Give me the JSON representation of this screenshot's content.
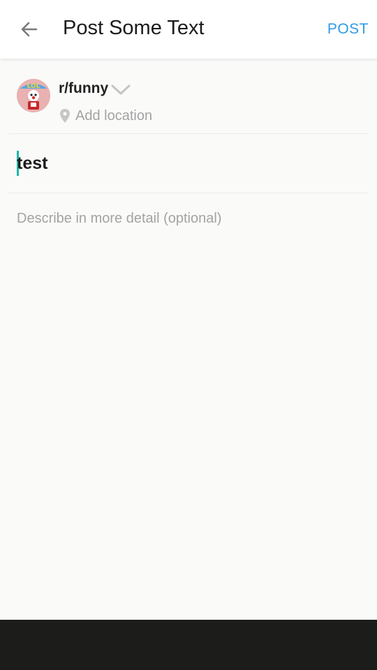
{
  "header": {
    "title": "Post Some Text",
    "post_label": "POST",
    "back_icon": "arrow-left-icon"
  },
  "community": {
    "name": "r/funny",
    "avatar_icon": "subreddit-avatar",
    "dropdown_icon": "chevron-down-icon"
  },
  "location": {
    "label": "Add location",
    "icon": "map-pin-icon"
  },
  "post": {
    "title_value": "test",
    "body_placeholder": "Describe in more detail (optional)"
  },
  "colors": {
    "accent": "#2f9be6",
    "caret": "#1ab9a6",
    "placeholder": "#a3a3a3",
    "bottom_bar": "#1c1c1b"
  }
}
